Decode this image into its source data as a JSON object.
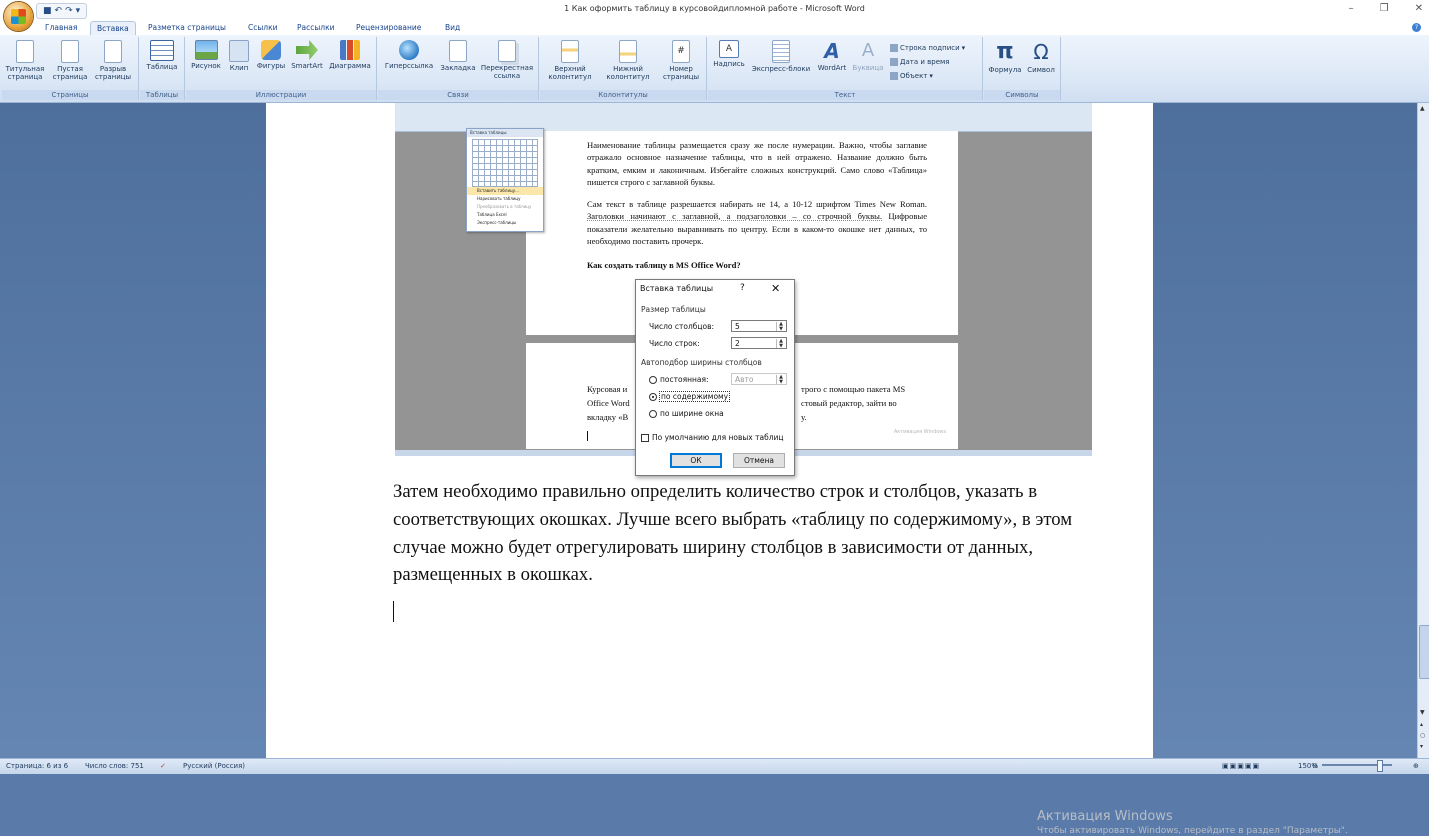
{
  "window": {
    "title": "1 Как оформить таблицу в курсовойдипломной работе - Microsoft Word"
  },
  "tabs": [
    "Главная",
    "Вставка",
    "Разметка страницы",
    "Ссылки",
    "Рассылки",
    "Рецензирование",
    "Вид"
  ],
  "active_tab": "Вставка",
  "ribbon": {
    "groups": {
      "pages": {
        "label": "Страницы",
        "cover": "Титульная страница",
        "blank": "Пустая страница",
        "break": "Разрыв страницы"
      },
      "tables": {
        "label": "Таблицы",
        "table": "Таблица"
      },
      "illustrations": {
        "label": "Иллюстрации",
        "picture": "Рисунок",
        "clip": "Клип",
        "shapes": "Фигуры",
        "smartart": "SmartArt",
        "chart": "Диаграмма"
      },
      "links": {
        "label": "Связи",
        "hyperlink": "Гиперссылка",
        "bookmark": "Закладка",
        "xref": "Перекрестная ссылка"
      },
      "header_footer": {
        "label": "Колонтитулы",
        "header": "Верхний колонтитул",
        "footer": "Нижний колонтитул",
        "page_number": "Номер страницы"
      },
      "text": {
        "label": "Текст",
        "textbox": "Надпись",
        "express": "Экспресс-блоки",
        "wordart": "WordArt",
        "dropcap": "Буквица",
        "signature": "Строка подписи",
        "datetime": "Дата и время",
        "object": "Объект"
      },
      "symbols": {
        "label": "Символы",
        "equation": "Формула",
        "symbol": "Символ"
      }
    }
  },
  "embedded_screenshot": {
    "menu_header": "Вставка таблицы",
    "menu_items": [
      "Вставить таблицу...",
      "Нарисовать таблицу",
      "Преобразовать в таблицу",
      "Таблица Excel",
      "Экспресс-таблицы"
    ],
    "paragraph1": "Наименование таблицы размещается сразу же после нумерации. Важно, чтобы заглавие отражало основное назначение таблицы, что в ней отражено. Название должно быть кратким, емким и лаконичным. Избегайте сложных конструкций. Само слово «Таблица» пишется строго с заглавной буквы.",
    "paragraph2_a": "Сам текст в таблице разрешается набирать не 14, а 10-12 шрифтом Times New Roman. ",
    "paragraph2_u": "Заголовки начинают с заглавной, а подзаголовки – со строчной буквы.",
    "paragraph2_b": " Цифровые показатели желательно выравнивать по центру. Если в каком-то окошке нет данных, то необходимо поставить прочерк.",
    "heading": "Как создать таблицу в MS Office Word?",
    "page2_line1_left": "Курсовая и",
    "page2_line1_right": "трого с помощью пакета MS",
    "page2_line2_left": "Office Word",
    "page2_line2_right": "стовый редактор, зайти во",
    "page2_line3_left": "вкладку «В",
    "page2_line3_right": "у.",
    "watermark": "Активация Windows"
  },
  "dialog": {
    "title": "Вставка таблицы",
    "help": "?",
    "close": "✕",
    "size_section": "Размер таблицы",
    "cols_label": "Число столбцов:",
    "cols_value": "5",
    "rows_label": "Число строк:",
    "rows_value": "2",
    "autofit_section": "Автоподбор ширины столбцов",
    "radio_fixed": "постоянная:",
    "fixed_value": "Авто",
    "radio_content": "по содержимому",
    "radio_window": "по ширине окна",
    "selected_radio": "по содержимому",
    "remember_checkbox": "По умолчанию для новых таблиц",
    "remember_checked": false,
    "ok": "ОК",
    "cancel": "Отмена"
  },
  "document": {
    "body": "Затем необходимо правильно определить количество строк и столбцов, указать в соответствующих окошках. Лучше всего выбрать «таблицу по содержимому», в этом случае можно будет отрегулировать ширину столбцов в зависимости от данных, размещенных в окошках."
  },
  "activation": {
    "line1": "Активация Windows",
    "line2": "Чтобы активировать Windows, перейдите в раздел \"Параметры\"."
  },
  "status": {
    "page": "Страница: 6 из 6",
    "words": "Число слов: 751",
    "language": "Русский (Россия)",
    "zoom": "150%"
  },
  "colors": {
    "accent": "#0078d7",
    "ribbon": "#dbe7f6",
    "workspace": "#5a7ba9"
  }
}
